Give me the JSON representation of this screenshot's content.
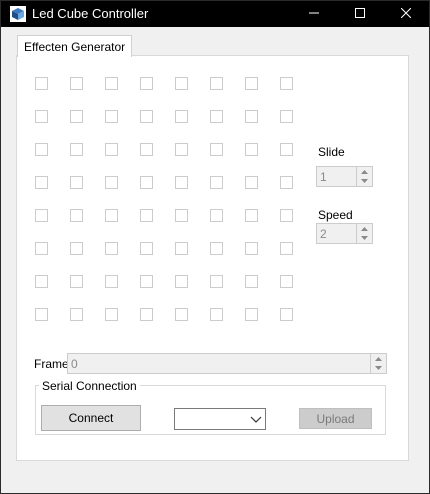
{
  "window": {
    "title": "Led Cube Controller",
    "icon": "cube-app-icon",
    "controls": [
      "minimize-icon",
      "maximize-icon",
      "close-icon"
    ]
  },
  "tabs": [
    {
      "label": "Effecten Generator",
      "active": true
    }
  ],
  "led_grid": {
    "rows": 8,
    "columns": 8,
    "checked": []
  },
  "slide": {
    "label": "Slide",
    "value": "1",
    "enabled": false
  },
  "speed": {
    "label": "Speed",
    "value": "2",
    "enabled": false
  },
  "frame": {
    "label": "Frame",
    "value": "0",
    "enabled": false
  },
  "serial": {
    "group_label": "Serial Connection",
    "connect_label": "Connect",
    "port_selected": "",
    "upload_label": "Upload",
    "upload_enabled": false
  }
}
